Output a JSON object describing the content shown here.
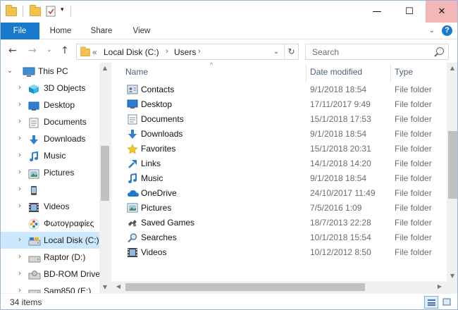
{
  "window": {
    "title": "",
    "min_symbol": "—",
    "max_symbol": "☐",
    "close_symbol": "✕"
  },
  "ribbon": {
    "file": "File",
    "home": "Home",
    "share": "Share",
    "view": "View"
  },
  "address": {
    "overflow": "«",
    "crumbs": [
      "Local Disk (C:)",
      "Users",
      ""
    ],
    "separator": "›",
    "search_placeholder": "Search",
    "search_suffix": ""
  },
  "navpane": {
    "items": [
      {
        "label": "This PC",
        "icon": "this-pc-icon",
        "arrow": "⌄",
        "selected": false
      },
      {
        "label": "3D Objects",
        "icon": "3d-objects-icon",
        "arrow": "›",
        "selected": false
      },
      {
        "label": "Desktop",
        "icon": "desktop-icon",
        "arrow": "›",
        "selected": false
      },
      {
        "label": "Documents",
        "icon": "documents-icon",
        "arrow": "›",
        "selected": false
      },
      {
        "label": "Downloads",
        "icon": "downloads-icon",
        "arrow": "›",
        "selected": false
      },
      {
        "label": "Music",
        "icon": "music-icon",
        "arrow": "›",
        "selected": false
      },
      {
        "label": "Pictures",
        "icon": "pictures-icon",
        "arrow": "›",
        "selected": false
      },
      {
        "label": "",
        "icon": "phone-icon",
        "arrow": "›",
        "selected": false
      },
      {
        "label": "Videos",
        "icon": "videos-icon",
        "arrow": "›",
        "selected": false
      },
      {
        "label": "Φωτογραφίες",
        "icon": "photos-icon",
        "arrow": "",
        "selected": false
      },
      {
        "label": "Local Disk (C:)",
        "icon": "local-disk-icon",
        "arrow": "›",
        "selected": true
      },
      {
        "label": "Raptor (D:)",
        "icon": "drive-icon",
        "arrow": "›",
        "selected": false
      },
      {
        "label": "BD-ROM Drive",
        "icon": "bd-rom-icon",
        "arrow": "›",
        "selected": false
      },
      {
        "label": "Sam850 (E:)",
        "icon": "drive-icon",
        "arrow": "›",
        "selected": false
      }
    ]
  },
  "columns": {
    "name": "Name",
    "date": "Date modified",
    "type": "Type"
  },
  "files": [
    {
      "name": "Contacts",
      "date": "9/1/2018 18:54",
      "type": "File folder",
      "icon": "contacts-icon"
    },
    {
      "name": "Desktop",
      "date": "17/11/2017 9:49",
      "type": "File folder",
      "icon": "desktop-icon"
    },
    {
      "name": "Documents",
      "date": "15/1/2018 17:53",
      "type": "File folder",
      "icon": "documents-icon"
    },
    {
      "name": "Downloads",
      "date": "9/1/2018 18:54",
      "type": "File folder",
      "icon": "downloads-icon"
    },
    {
      "name": "Favorites",
      "date": "15/1/2018 20:31",
      "type": "File folder",
      "icon": "favorites-star-icon"
    },
    {
      "name": "Links",
      "date": "14/1/2018 14:20",
      "type": "File folder",
      "icon": "links-icon"
    },
    {
      "name": "Music",
      "date": "9/1/2018 18:54",
      "type": "File folder",
      "icon": "music-icon"
    },
    {
      "name": "OneDrive",
      "date": "24/10/2017 11:49",
      "type": "File folder",
      "icon": "onedrive-cloud-icon"
    },
    {
      "name": "Pictures",
      "date": "7/5/2016 1:09",
      "type": "File folder",
      "icon": "pictures-icon"
    },
    {
      "name": "Saved Games",
      "date": "18/7/2013 22:28",
      "type": "File folder",
      "icon": "saved-games-icon"
    },
    {
      "name": "Searches",
      "date": "10/1/2018 15:54",
      "type": "File folder",
      "icon": "searches-icon"
    },
    {
      "name": "Videos",
      "date": "10/12/2012 8:50",
      "type": "File folder",
      "icon": "videos-icon"
    }
  ],
  "status": {
    "count": "34 items"
  },
  "colors": {
    "accent": "#1979ca",
    "selection": "#cce8ff",
    "folder": "#f2c14e"
  }
}
